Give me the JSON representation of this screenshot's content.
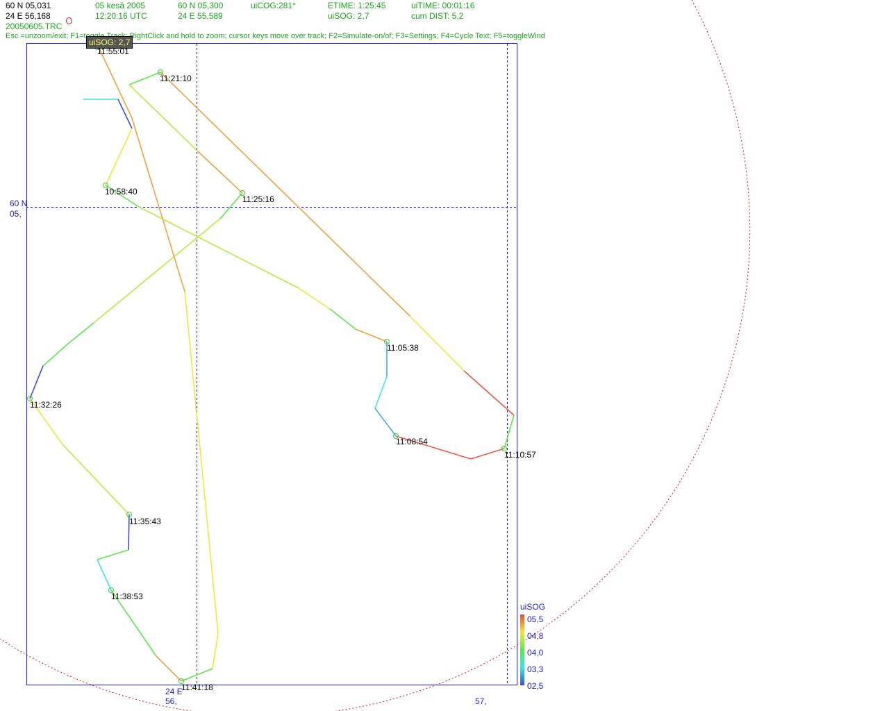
{
  "header": {
    "lat": "60 N 05,031",
    "lon": "24 E 56,168",
    "date": "05 kesä 2005",
    "utc_time": "12:20:16 UTC",
    "cursor_lat": "60 N 05,300",
    "cursor_lon": "24 E 55,589",
    "uicog": "uiCOG:281°",
    "uisog": "uiSOG: 2,7",
    "etime": "ETIME: 1:25:45",
    "uitime": "uiTIME: 00:01:16",
    "cum_dist": "cum DIST: 5,2",
    "filename": "20050605.TRC",
    "help": "Esc =unzoom/exit; F1=toggle Track; RightClick and hold to zoom; cursor keys move over track; F2=Simulate-on/of; F3=Settings; F4=Cycle Text; F5=toggleWind"
  },
  "tooltip": "uiSOG: 2,7",
  "waypoints": [
    {
      "time": "11:55:01"
    },
    {
      "time": "11:21:10"
    },
    {
      "time": "10:58:40"
    },
    {
      "time": "11:25:16"
    },
    {
      "time": "11:05:38"
    },
    {
      "time": "11:32:26"
    },
    {
      "time": "11:08:54"
    },
    {
      "time": "11:10:57"
    },
    {
      "time": "11:35:43"
    },
    {
      "time": "11:38:53"
    },
    {
      "time": "11:41:18"
    }
  ],
  "axis": {
    "lat_line1": "60 N",
    "lat_line2": "05,",
    "lon_line1": "24 E",
    "lon_line2": "56,",
    "lon_right": "57,"
  },
  "legend": {
    "title": "uiSOG",
    "labels": [
      "05,5",
      "04,8",
      "04,0",
      "03,3",
      "02,5"
    ],
    "colors": [
      "#ec4a3a",
      "#f2e63a",
      "#5ae84a",
      "#3ae6e6",
      "#3a4ae6"
    ]
  },
  "colors": {
    "frame": "#1a1ad6",
    "grid": "#1a1ad6",
    "range_circle": "#e01010",
    "waypoint": "#3ac83a"
  }
}
